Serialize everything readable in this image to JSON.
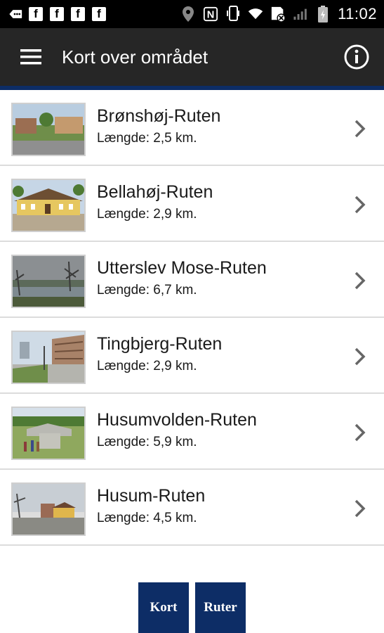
{
  "statusbar": {
    "time": "11:02",
    "fb_letter": "f",
    "nfc_letter": "N",
    "left_icons": [
      "back-chat-icon",
      "facebook-icon",
      "facebook-icon",
      "facebook-icon",
      "facebook-icon"
    ],
    "right_icons": [
      "location-icon",
      "nfc-icon",
      "vibrate-icon",
      "wifi-icon",
      "sim-icon",
      "signal-icon",
      "battery-icon"
    ]
  },
  "appbar": {
    "title": "Kort over området",
    "menu_icon": "menu-icon",
    "info_icon": "info-icon",
    "background": "#262626",
    "accent": "#0d2d66"
  },
  "routes": [
    {
      "title": "Brønshøj-Ruten",
      "length": "Længde: 2,5 km."
    },
    {
      "title": "Bellahøj-Ruten",
      "length": "Længde: 2,9 km."
    },
    {
      "title": "Utterslev Mose-Ruten",
      "length": "Længde: 6,7 km."
    },
    {
      "title": "Tingbjerg-Ruten",
      "length": "Længde: 2,9 km."
    },
    {
      "title": "Husumvolden-Ruten",
      "length": "Længde: 5,9 km."
    },
    {
      "title": "Husum-Ruten",
      "length": "Længde: 4,5 km."
    }
  ],
  "buttons": {
    "kort": "Kort",
    "ruter": "Ruter",
    "color": "#0d2d66"
  }
}
